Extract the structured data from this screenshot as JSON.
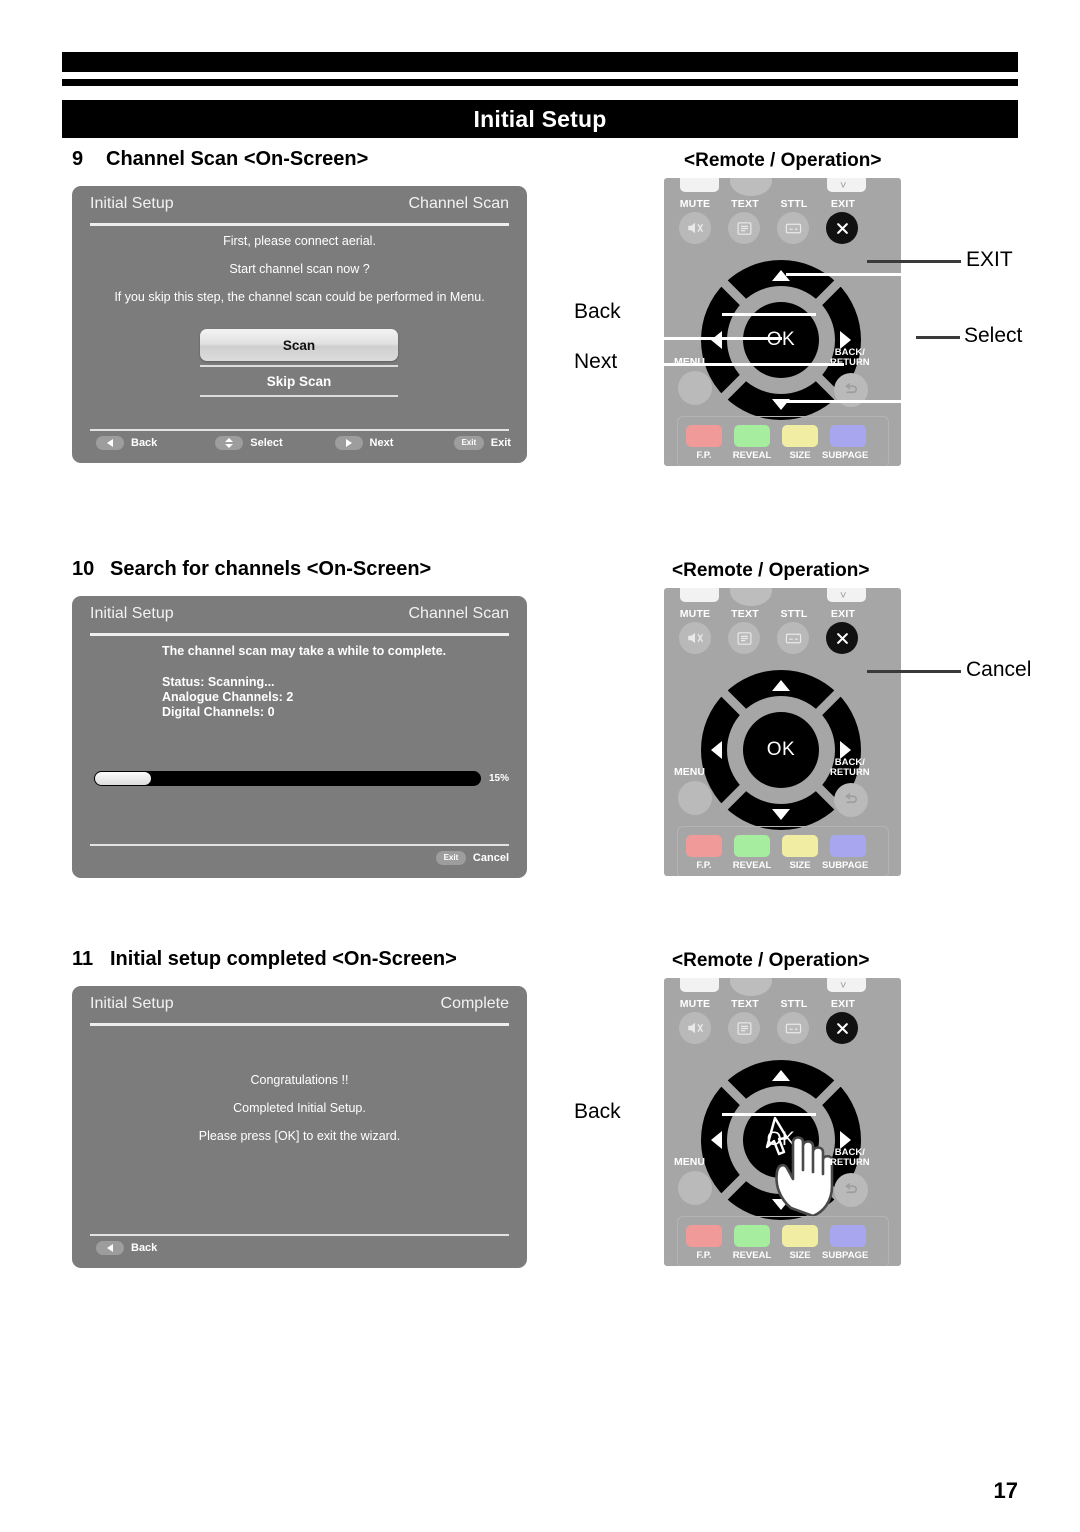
{
  "document": {
    "title": "Initial Setup",
    "page_number": "17"
  },
  "sections": [
    {
      "number": "9",
      "heading": "Channel Scan <On-Screen>",
      "remote_heading": "<Remote / Operation>",
      "panel": {
        "title_left": "Initial Setup",
        "title_right": "Channel Scan",
        "lines": [
          "First, please connect aerial.",
          "Start channel scan now ?",
          "If you skip this step, the channel scan could be performed in Menu."
        ],
        "primary_button": "Scan",
        "secondary_button": "Skip Scan",
        "footer": [
          {
            "icon": "dpad-left-icon",
            "label": "Back"
          },
          {
            "icon": "dpad-updown-icon",
            "label": "Select"
          },
          {
            "icon": "dpad-right-icon",
            "label": "Next"
          },
          {
            "icon": "exit-badge-icon",
            "badge": "Exit",
            "label": "Exit"
          }
        ]
      },
      "callouts": [
        {
          "name": "exit",
          "label": "EXIT"
        },
        {
          "name": "back",
          "label": "Back"
        },
        {
          "name": "next",
          "label": "Next"
        },
        {
          "name": "select",
          "label": "Select"
        }
      ]
    },
    {
      "number": "10",
      "heading": "Search for channels <On-Screen>",
      "remote_heading": "<Remote / Operation>",
      "panel": {
        "title_left": "Initial Setup",
        "title_right": "Channel Scan",
        "message": "The channel scan may take a while to complete.",
        "status_lines": [
          "Status: Scanning...",
          "Analogue Channels: 2",
          "Digital Channels: 0"
        ],
        "progress_percent": "15%",
        "footer_right": {
          "badge": "Exit",
          "label": "Cancel"
        }
      },
      "callouts": [
        {
          "name": "cancel",
          "label": "Cancel"
        }
      ]
    },
    {
      "number": "11",
      "heading": "Initial setup completed <On-Screen>",
      "remote_heading": "<Remote / Operation>",
      "panel": {
        "title_left": "Initial Setup",
        "title_right": "Complete",
        "lines": [
          "Congratulations !!",
          "Completed Initial Setup.",
          "Please press [OK] to exit the wizard."
        ],
        "footer": [
          {
            "icon": "dpad-left-icon",
            "label": "Back"
          }
        ]
      },
      "callouts": [
        {
          "name": "back",
          "label": "Back"
        }
      ]
    }
  ],
  "remote": {
    "top_row_labels": [
      "MUTE",
      "TEXT",
      "STTL",
      "EXIT"
    ],
    "ok_label": "OK",
    "menu_label": "MENU",
    "back_return_label": "BACK/\nRETURN",
    "back_return_line1": "BACK/",
    "back_return_line2": "RETURN",
    "color_buttons": [
      {
        "label": "F.P.",
        "color": "#f09a9a"
      },
      {
        "label": "REVEAL",
        "color": "#a6eda0"
      },
      {
        "label": "SIZE",
        "color": "#f1eda3"
      },
      {
        "label": "SUBPAGE",
        "color": "#a7a6ef"
      }
    ],
    "icons": {
      "mute": "mute-icon",
      "text": "text-icon",
      "sttl": "subtitle-icon",
      "exit": "exit-cross-icon",
      "back_return": "return-arrow-icon",
      "hand": "hand-pointer-icon"
    }
  }
}
